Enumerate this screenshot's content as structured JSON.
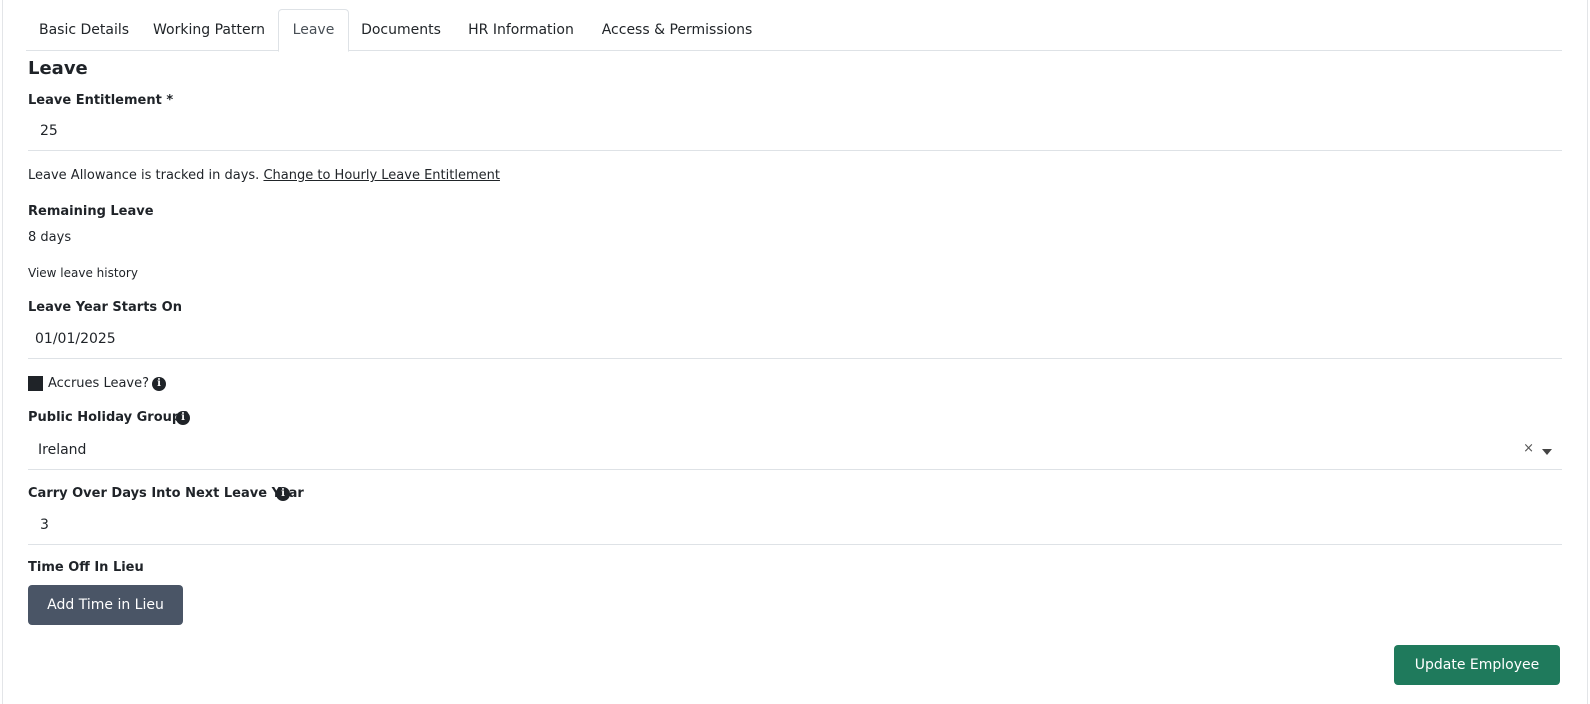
{
  "tabs": [
    {
      "label": "Basic Details"
    },
    {
      "label": "Working Pattern"
    },
    {
      "label": "Leave"
    },
    {
      "label": "Documents"
    },
    {
      "label": "HR Information"
    },
    {
      "label": "Access & Permissions"
    }
  ],
  "active_tab": "Leave",
  "section_title": "Leave",
  "leave_entitlement": {
    "label": "Leave Entitlement *",
    "value": "25"
  },
  "allowance_note": {
    "text": "Leave Allowance is tracked in days. ",
    "link": "Change to Hourly Leave Entitlement"
  },
  "remaining_leave": {
    "label": "Remaining Leave",
    "value": "8 days",
    "history_link": "View leave history"
  },
  "leave_year_start": {
    "label": "Leave Year Starts On",
    "value": "01/01/2025"
  },
  "accrues_leave": {
    "label": "Accrues Leave?",
    "checked": true
  },
  "public_holiday_group": {
    "label": "Public Holiday Group?",
    "value": "Ireland",
    "clear_glyph": "×"
  },
  "carry_over": {
    "label": "Carry Over Days Into Next Leave Year",
    "value": "3"
  },
  "time_off_in_lieu": {
    "label": "Time Off In Lieu",
    "button": "Add Time in Lieu"
  },
  "update_button": "Update Employee",
  "info_glyph": "i",
  "colors": {
    "primary_button": "#1f7a5c",
    "secondary_button": "#4a5566"
  }
}
